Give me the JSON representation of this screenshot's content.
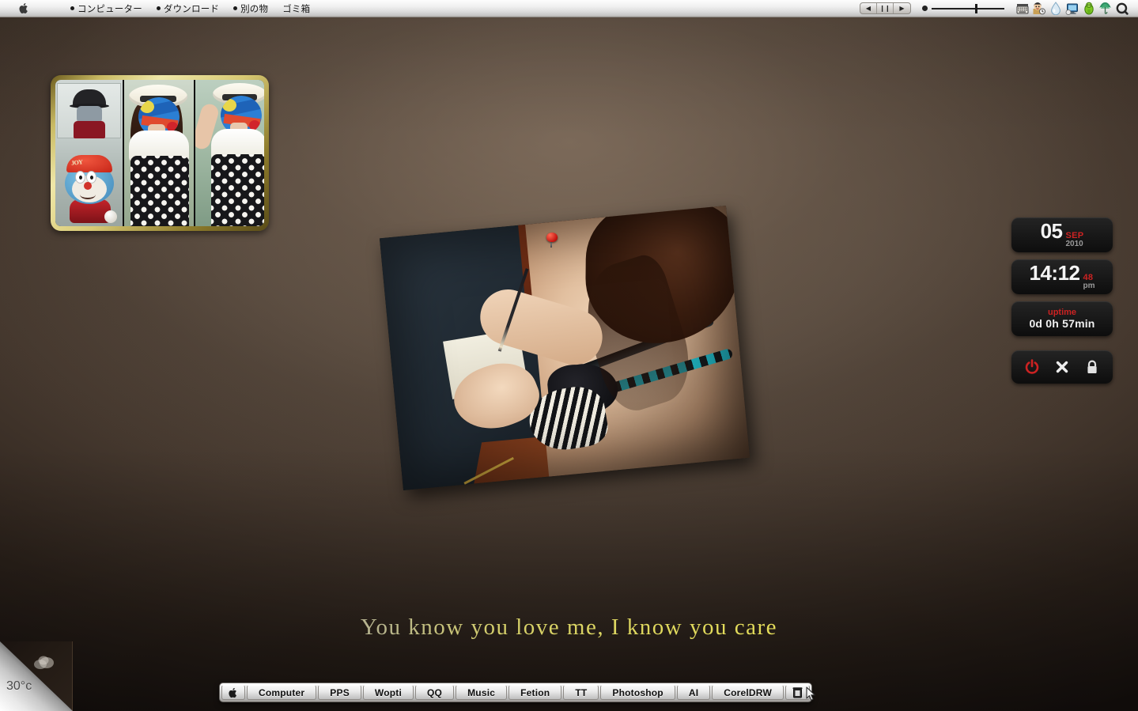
{
  "menubar": {
    "apple_icon": "apple-logo-icon",
    "items": [
      {
        "label": "コンピューター",
        "bullet": true
      },
      {
        "label": "ダウンロード",
        "bullet": true
      },
      {
        "label": "別の物",
        "bullet": true
      },
      {
        "label": "ゴミ箱",
        "bullet": false
      }
    ],
    "media": {
      "prev_label": "◀",
      "pause_label": "❙❙",
      "next_label": "▶"
    },
    "volume": {
      "level_percent": 60
    },
    "status_icons": [
      "keyboard-input-icon",
      "user-avatar-icon",
      "water-drop-icon",
      "display-monitor-icon",
      "green-figure-icon",
      "umbrella-tree-icon",
      "spotlight-search-icon"
    ]
  },
  "collage": {
    "name": "photo-collage-widget",
    "panes": [
      {
        "caption": "plush-toys-photo"
      },
      {
        "caption": "girl-with-hat-photo-1"
      },
      {
        "caption": "girl-with-hat-photo-2"
      }
    ],
    "cap_text": "JOY"
  },
  "center_photo": {
    "name": "pinned-desk-photo",
    "pin": "red-pushpin-icon",
    "rotation_deg": -5.4
  },
  "tagline": {
    "text": "You know you love me, I know you care"
  },
  "widgets": {
    "date": {
      "day": "05",
      "month": "SEP",
      "year": "2010"
    },
    "clock": {
      "time": "14:12",
      "seconds": "48",
      "meridiem": "pm"
    },
    "uptime": {
      "label": "uptime",
      "value": "0d 0h 57min"
    },
    "power_buttons": [
      {
        "name": "shutdown-button",
        "icon": "power-icon",
        "color": "#cc2222"
      },
      {
        "name": "logout-button",
        "icon": "close-x-icon",
        "color": "#e8e8e8"
      },
      {
        "name": "lock-button",
        "icon": "lock-icon",
        "color": "#e2e2e2"
      }
    ]
  },
  "weather": {
    "temperature": "30°c",
    "icon": "cloud-icon"
  },
  "dock": {
    "items": [
      {
        "label": "",
        "icon": "apple-logo-icon",
        "icon_only": true
      },
      {
        "label": "Computer",
        "icon": null,
        "icon_only": false
      },
      {
        "label": "PPS",
        "icon": null,
        "icon_only": false
      },
      {
        "label": "Wopti",
        "icon": null,
        "icon_only": false
      },
      {
        "label": "QQ",
        "icon": null,
        "icon_only": false
      },
      {
        "label": "Music",
        "icon": null,
        "icon_only": false
      },
      {
        "label": "Fetion",
        "icon": null,
        "icon_only": false
      },
      {
        "label": "TT",
        "icon": null,
        "icon_only": false
      },
      {
        "label": "Photoshop",
        "icon": null,
        "icon_only": false
      },
      {
        "label": "AI",
        "icon": null,
        "icon_only": false
      },
      {
        "label": "CorelDRW",
        "icon": null,
        "icon_only": false
      },
      {
        "label": "",
        "icon": "trash-icon",
        "icon_only": true
      }
    ]
  },
  "colors": {
    "accent_red": "#cc2222",
    "tagline_yellow": "#e6de58",
    "desktop_brown": "#5b4d41",
    "widget_black": "#181818"
  }
}
